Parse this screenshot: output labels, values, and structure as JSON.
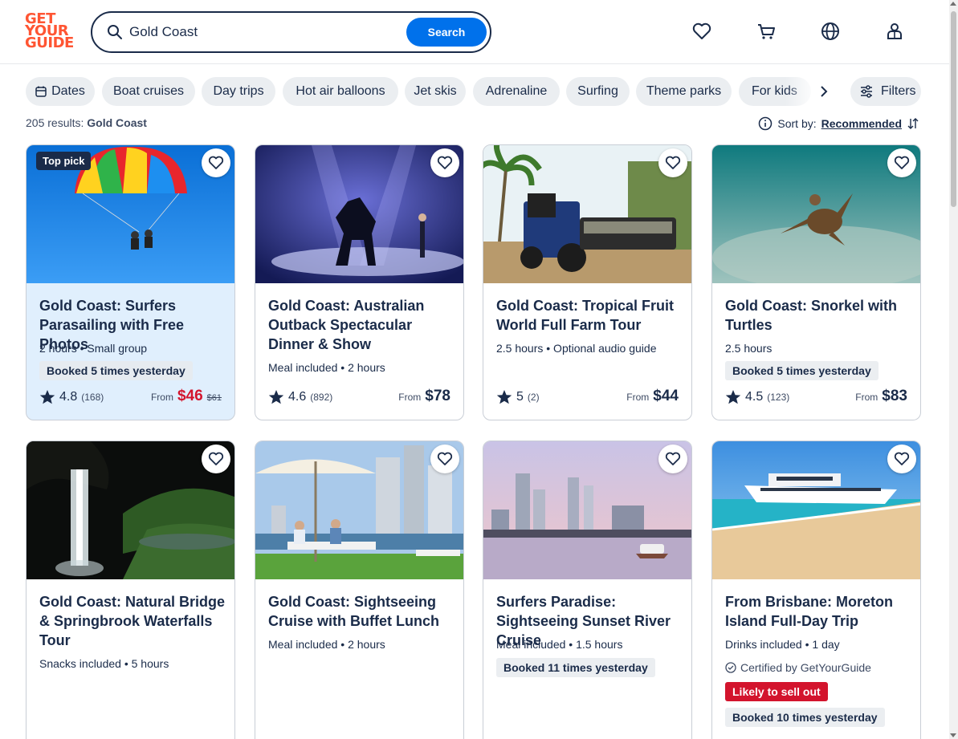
{
  "brand": {
    "logo_lines": [
      "GET",
      "YOUR",
      "GUIDE"
    ],
    "color": "#ff5533"
  },
  "search": {
    "value": "Gold Coast",
    "button": "Search"
  },
  "header_icons": [
    "heart-icon",
    "cart-icon",
    "globe-icon",
    "profile-icon"
  ],
  "chips": {
    "items": [
      "Dates",
      "Boat cruises",
      "Day trips",
      "Hot air balloons",
      "Jet skis",
      "Adrenaline",
      "Surfing",
      "Theme parks",
      "For kids"
    ],
    "filters": "Filters"
  },
  "results": {
    "count": "205 results:",
    "query": "Gold Coast"
  },
  "sort": {
    "label": "Sort by:",
    "value": "Recommended"
  },
  "cards": [
    {
      "top_pick": "Top pick",
      "title": "Gold Coast: Surfers Parasailing with Free Photos",
      "meta": "2 hours • Small group",
      "badge": "Booked 5 times yesterday",
      "rating": "4.8",
      "reviews": "(168)",
      "from": "From",
      "price": "$46",
      "old_price": "$61"
    },
    {
      "title": "Gold Coast: Australian Outback Spectacular Dinner & Show",
      "meta": "Meal included • 2 hours",
      "rating": "4.6",
      "reviews": "(892)",
      "from": "From",
      "price": "$78"
    },
    {
      "title": "Gold Coast: Tropical Fruit World Full Farm Tour",
      "meta": "2.5 hours • Optional audio guide",
      "rating": "5",
      "reviews": "(2)",
      "from": "From",
      "price": "$44"
    },
    {
      "title": "Gold Coast: Snorkel with Turtles",
      "meta": "2.5 hours",
      "badge": "Booked 5 times yesterday",
      "rating": "4.5",
      "reviews": "(123)",
      "from": "From",
      "price": "$83"
    },
    {
      "title": "Gold Coast: Natural Bridge & Springbrook Waterfalls Tour",
      "meta": "Snacks included • 5 hours"
    },
    {
      "title": "Gold Coast: Sightseeing Cruise with Buffet Lunch",
      "meta": "Meal included • 2 hours"
    },
    {
      "title": "Surfers Paradise: Sightseeing Sunset River Cruise",
      "meta": "Meal included • 1.5 hours",
      "badge": "Booked 11 times yesterday"
    },
    {
      "title": "From Brisbane: Moreton Island Full-Day Trip",
      "meta": "Drinks included • 1 day",
      "certified": "Certified by GetYourGuide",
      "urgency": "Likely to sell out",
      "badge": "Booked 10 times yesterday"
    }
  ]
}
